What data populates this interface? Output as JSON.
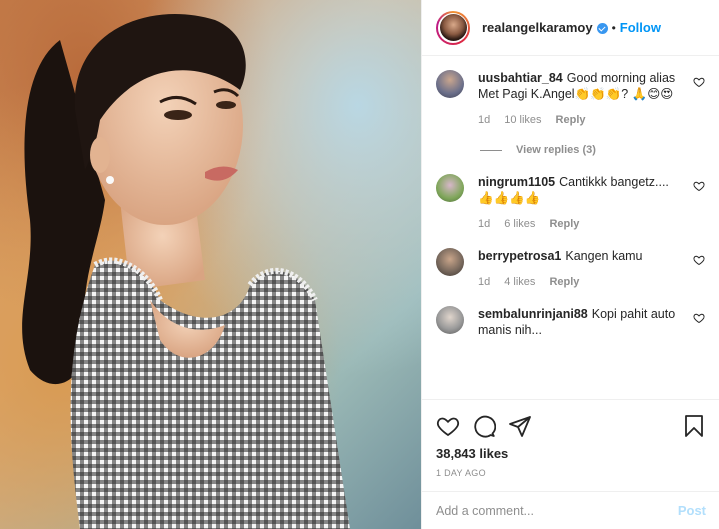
{
  "header": {
    "username": "realangelkaramoy",
    "verified": true,
    "separator": "•",
    "follow_label": "Follow"
  },
  "comments": [
    {
      "username": "uusbahtiar_84",
      "text": "Good morning alias Met Pagi K.Angel👏👏👏? 🙏😊😍",
      "age": "1d",
      "likes": "10 likes",
      "reply_label": "Reply",
      "avatar_color": "#6b6f8a"
    },
    {
      "username": "ningrum1105",
      "text": "Cantikkk bangetz....👍👍👍👍",
      "age": "1d",
      "likes": "6 likes",
      "reply_label": "Reply",
      "avatar_color": "#7fa65a"
    },
    {
      "username": "berrypetrosa1",
      "text": "Kangen kamu",
      "age": "1d",
      "likes": "4 likes",
      "reply_label": "Reply",
      "avatar_color": "#7a6a5e"
    },
    {
      "username": "sembalunrinjani88",
      "text": "Kopi pahit auto manis nih...",
      "age": "",
      "likes": "",
      "reply_label": "",
      "avatar_color": "#9a9a9a"
    }
  ],
  "view_replies": "View replies (3)",
  "actions": {
    "icons": [
      "heart-icon",
      "comment-icon",
      "share-icon",
      "bookmark-icon"
    ]
  },
  "likes_count": "38,843 likes",
  "timestamp": "1 DAY AGO",
  "add_comment": {
    "placeholder": "Add a comment...",
    "post_label": "Post"
  },
  "colors": {
    "link_blue": "#0095f6",
    "post_disabled": "#b2dffc",
    "muted": "#8e8e8e",
    "text": "#262626"
  }
}
